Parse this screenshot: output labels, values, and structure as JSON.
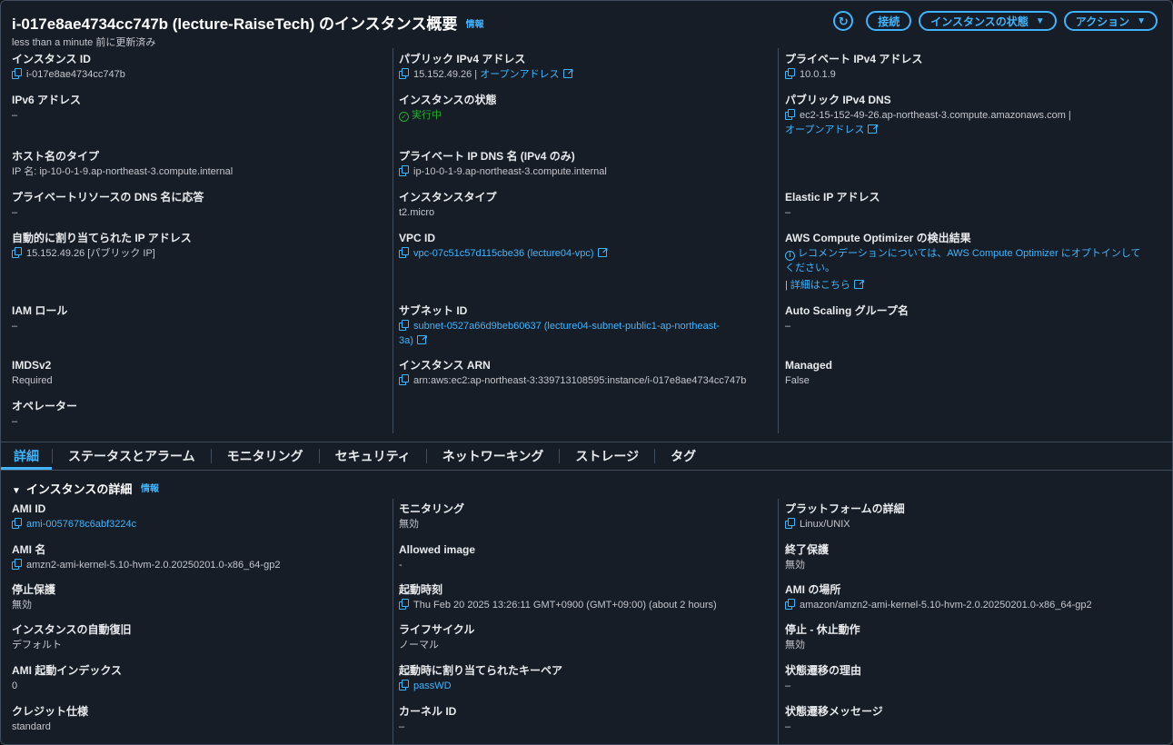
{
  "header": {
    "title": "i-017e8ae4734cc747b (lecture-RaiseTech) のインスタンス概要",
    "info_label": "情報",
    "updated": "less than a minute 前に更新済み",
    "refresh_icon": "refresh-icon",
    "connect_label": "接続",
    "instance_state_label": "インスタンスの状態",
    "actions_label": "アクション"
  },
  "summary": {
    "instance_id": {
      "label": "インスタンス ID",
      "value": "i-017e8ae4734cc747b"
    },
    "public_ipv4": {
      "label": "パブリック IPv4 アドレス",
      "value": "15.152.49.26 |",
      "link": "オープンアドレス"
    },
    "private_ipv4": {
      "label": "プライベート IPv4 アドレス",
      "value": "10.0.1.9"
    },
    "ipv6": {
      "label": "IPv6 アドレス",
      "value": "–"
    },
    "instance_state": {
      "label": "インスタンスの状態",
      "value": "実行中",
      "color": "#29ad32"
    },
    "public_dns": {
      "label": "パブリック IPv4 DNS",
      "value": "ec2-15-152-49-26.ap-northeast-3.compute.amazonaws.com |",
      "link": "オープンアドレス"
    },
    "hostname_type": {
      "label": "ホスト名のタイプ",
      "value": "IP 名: ip-10-0-1-9.ap-northeast-3.compute.internal"
    },
    "private_dns": {
      "label": "プライベート IP DNS 名 (IPv4 のみ)",
      "value": "ip-10-0-1-9.ap-northeast-3.compute.internal"
    },
    "private_resource_dns": {
      "label": "プライベートリソースの DNS 名に応答",
      "value": "–"
    },
    "instance_type": {
      "label": "インスタンスタイプ",
      "value": "t2.micro"
    },
    "elastic_ip": {
      "label": "Elastic IP アドレス",
      "value": "–"
    },
    "auto_ip": {
      "label": "自動的に割り当てられた IP アドレス",
      "value": "15.152.49.26 [パブリック IP]"
    },
    "vpc_id": {
      "label": "VPC ID",
      "value": "vpc-07c51c57d115cbe36 (lecture04-vpc)"
    },
    "optimizer": {
      "label": "AWS Compute Optimizer の検出結果",
      "text1": "レコメンデーションについては、AWS Compute Optimizer にオプトインして",
      "text2": "ください。",
      "sep": "|",
      "link": "詳細はこちら"
    },
    "iam_role": {
      "label": "IAM ロール",
      "value": "–"
    },
    "subnet_id": {
      "label": "サブネット ID",
      "value1": "subnet-0527a66d9beb60637 (lecture04-subnet-public1-ap-northeast-",
      "value2": "3a)"
    },
    "asg": {
      "label": "Auto Scaling グループ名",
      "value": "–"
    },
    "imdsv2": {
      "label": "IMDSv2",
      "value": "Required"
    },
    "arn": {
      "label": "インスタンス ARN",
      "value": "arn:aws:ec2:ap-northeast-3:339713108595:instance/i-017e8ae4734cc747b"
    },
    "managed": {
      "label": "Managed",
      "value": "False"
    },
    "operator": {
      "label": "オペレーター",
      "value": "–"
    }
  },
  "tabs": [
    "詳細",
    "ステータスとアラーム",
    "モニタリング",
    "セキュリティ",
    "ネットワーキング",
    "ストレージ",
    "タグ"
  ],
  "details": {
    "title": "インスタンスの詳細",
    "info_label": "情報",
    "ami_id": {
      "label": "AMI ID",
      "value": "ami-0057678c6abf3224c"
    },
    "monitoring": {
      "label": "モニタリング",
      "value": "無効"
    },
    "platform": {
      "label": "プラットフォームの詳細",
      "value": "Linux/UNIX"
    },
    "ami_name": {
      "label": "AMI 名",
      "value": "amzn2-ami-kernel-5.10-hvm-2.0.20250201.0-x86_64-gp2"
    },
    "allowed_image": {
      "label": "Allowed image",
      "value": "-"
    },
    "termination_protection": {
      "label": "終了保護",
      "value": "無効"
    },
    "stop_protection": {
      "label": "停止保護",
      "value": "無効"
    },
    "launch_time": {
      "label": "起動時刻",
      "value": "Thu Feb 20 2025 13:26:11 GMT+0900 (GMT+09:00) (about 2 hours)"
    },
    "ami_location": {
      "label": "AMI の場所",
      "value": "amazon/amzn2-ami-kernel-5.10-hvm-2.0.20250201.0-x86_64-gp2"
    },
    "auto_recovery": {
      "label": "インスタンスの自動復旧",
      "value": "デフォルト"
    },
    "lifecycle": {
      "label": "ライフサイクル",
      "value": "ノーマル"
    },
    "stop_hibernate": {
      "label": "停止 - 休止動作",
      "value": "無効"
    },
    "ami_launch_index": {
      "label": "AMI 起動インデックス",
      "value": "0"
    },
    "key_pair": {
      "label": "起動時に割り当てられたキーペア",
      "value": "passWD"
    },
    "transition_reason": {
      "label": "状態遷移の理由",
      "value": "–"
    },
    "credit_spec": {
      "label": "クレジット仕様",
      "value": "standard"
    },
    "kernel_id": {
      "label": "カーネル ID",
      "value": "–"
    },
    "transition_message": {
      "label": "状態遷移メッセージ",
      "value": "–"
    }
  }
}
